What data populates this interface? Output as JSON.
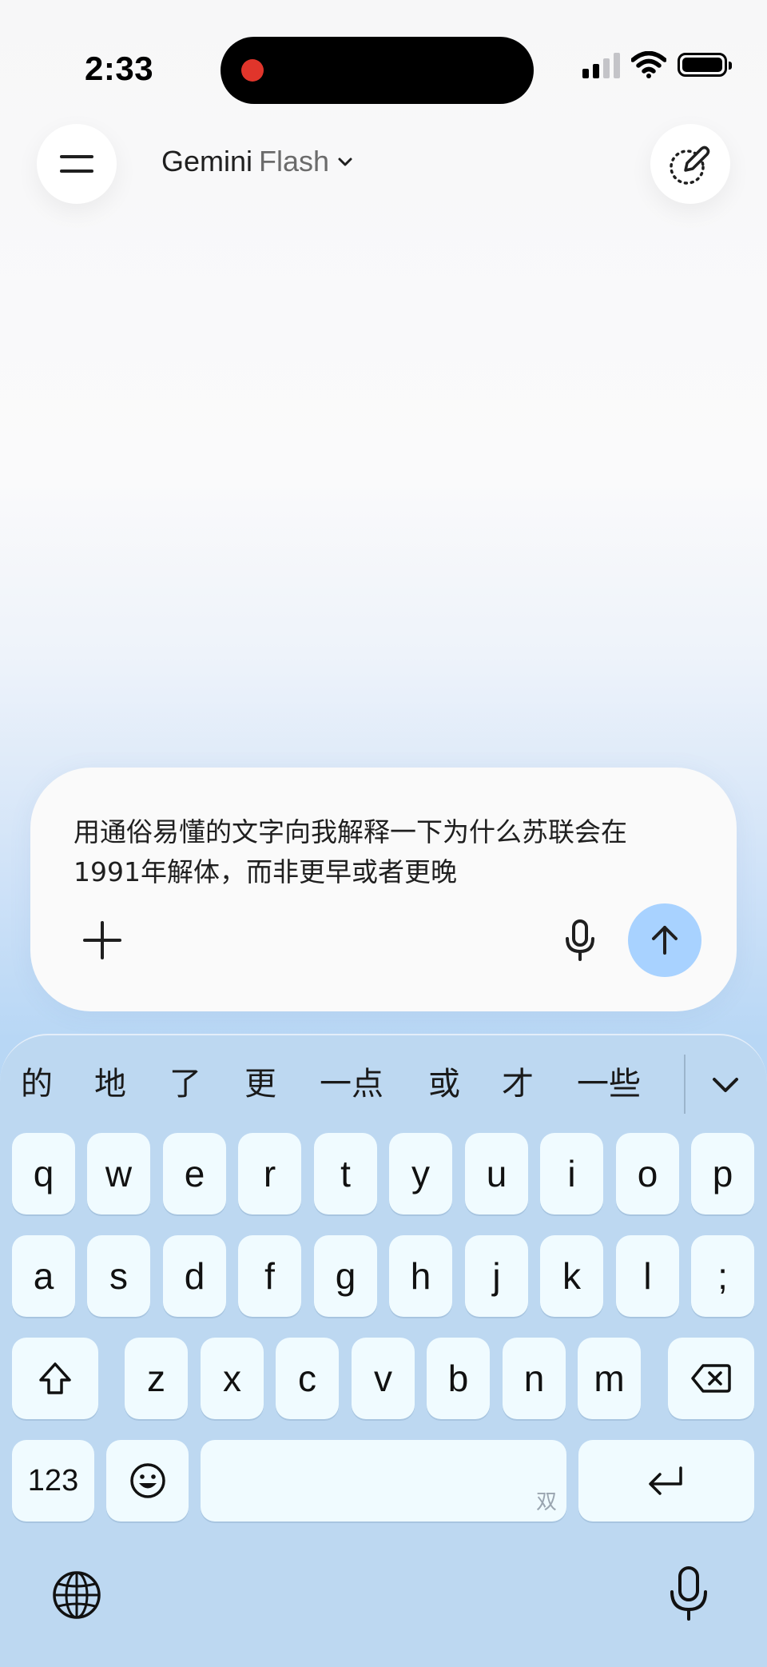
{
  "status": {
    "time": "2:33"
  },
  "header": {
    "model_name": "Gemini",
    "model_variant": "Flash"
  },
  "composer": {
    "prompt": "用通俗易懂的文字向我解释一下为什么苏联会在1991年解体，而非更早或者更晚"
  },
  "keyboard": {
    "suggestions": [
      "的",
      "地",
      "了",
      "更",
      "一点",
      "或",
      "才",
      "一些"
    ],
    "row1": [
      "q",
      "w",
      "e",
      "r",
      "t",
      "y",
      "u",
      "i",
      "o",
      "p"
    ],
    "row2": [
      "a",
      "s",
      "d",
      "f",
      "g",
      "h",
      "j",
      "k",
      "l",
      ";"
    ],
    "row3": [
      "z",
      "x",
      "c",
      "v",
      "b",
      "n",
      "m"
    ],
    "numbers_label": "123",
    "space_hint": "双"
  },
  "colors": {
    "send_button": "#a8d2ff",
    "keyboard_bg": "#bdd8f1",
    "key_bg": "#f0fbff",
    "recording_dot": "#e0352b"
  },
  "icons": {
    "menu": "menu-icon",
    "new_chat": "edit-pen-icon",
    "model_dropdown": "chevron-down-icon",
    "add": "plus-icon",
    "voice": "microphone-icon",
    "send": "arrow-up-icon",
    "shift": "shift-icon",
    "backspace": "backspace-icon",
    "emoji": "emoji-icon",
    "return": "return-icon",
    "globe": "globe-icon",
    "dictation": "microphone-icon"
  }
}
